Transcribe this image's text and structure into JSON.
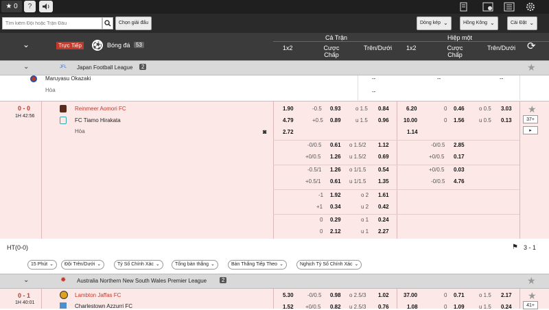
{
  "topbar": {
    "star_count": "0",
    "help": "?",
    "icons": [
      "sound-icon",
      "betslip-icon",
      "results-icon",
      "stats-icon",
      "settings-icon"
    ]
  },
  "search": {
    "placeholder": "Tìm kiếm Đội hoặc Trận Đấu",
    "choose_label": "Chọn giải đấu"
  },
  "dropdowns": {
    "odds_type": "Dòng kép",
    "odds_format": "Hồng Kông",
    "settings": "Cài Đặt"
  },
  "header": {
    "live_label": "Trực Tiếp",
    "sport": "Bóng đá",
    "sport_count": "53",
    "full_time": "Cả Trận",
    "half_time": "Hiệp một",
    "col_1x2": "1x2",
    "col_handicap_1": "Cược",
    "col_handicap_2": "Chấp",
    "col_ou": "Trên/Dưới"
  },
  "league1": {
    "name": "Japan Football League",
    "count": "2"
  },
  "prev_match": {
    "team": "Maruyasu Okazaki",
    "draw": "Hòa",
    "dash": "--"
  },
  "match1": {
    "score_home": "0",
    "score_sep": "-",
    "score_away": "0",
    "time": "1H 42:56",
    "home": "Reinmeer Aomori FC",
    "away": "FC Tiamo Hirakata",
    "draw": "Hòa",
    "more": "37+",
    "ft_1x2": [
      "1.90",
      "4.79",
      "2.72"
    ],
    "ht_1x2": [
      "6.20",
      "10.00",
      "1.14"
    ],
    "ft_hdp_main": {
      "lines": [
        "-0.5",
        "+0.5"
      ],
      "odds": [
        "0.93",
        "0.89"
      ]
    },
    "ft_ou_main": {
      "lines": [
        "o 1.5",
        "u 1.5"
      ],
      "odds": [
        "0.84",
        "0.96"
      ]
    },
    "ht_hdp_main": {
      "lines": [
        "0",
        "0"
      ],
      "odds": [
        "0.46",
        "1.56"
      ]
    },
    "ht_ou_main": {
      "lines": [
        "o 0.5",
        "u 0.5"
      ],
      "odds": [
        "3.03",
        "0.13"
      ]
    },
    "extra_rows": [
      {
        "hdp": [
          "-0/0.5",
          "+0/0.5"
        ],
        "hdp_odds": [
          "0.61",
          "1.26"
        ],
        "ou": [
          "o 1.5/2",
          "u 1.5/2"
        ],
        "ou_odds": [
          "1.12",
          "0.69"
        ],
        "ht_hdp": [
          "-0/0.5",
          "+0/0.5"
        ],
        "ht_hdp_odds": [
          "2.85",
          "0.17"
        ]
      },
      {
        "hdp": [
          "-0.5/1",
          "+0.5/1"
        ],
        "hdp_odds": [
          "1.26",
          "0.61"
        ],
        "ou": [
          "o 1/1.5",
          "u 1/1.5"
        ],
        "ou_odds": [
          "0.54",
          "1.35"
        ],
        "ht_hdp": [
          "+0/0.5",
          "-0/0.5"
        ],
        "ht_hdp_odds": [
          "0.03",
          "4.76"
        ]
      },
      {
        "hdp": [
          "-1",
          "+1"
        ],
        "hdp_odds": [
          "1.92",
          "0.34"
        ],
        "ou": [
          "o 2",
          "u 2"
        ],
        "ou_odds": [
          "1.61",
          "0.42"
        ],
        "ht_hdp": [
          "",
          ""
        ],
        "ht_hdp_odds": [
          "",
          ""
        ]
      },
      {
        "hdp": [
          "0",
          "0"
        ],
        "hdp_odds": [
          "0.29",
          "2.12"
        ],
        "ou": [
          "o 1",
          "u 1"
        ],
        "ou_odds": [
          "0.24",
          "2.27"
        ],
        "ht_hdp": [
          "",
          ""
        ],
        "ht_hdp_odds": [
          "",
          ""
        ]
      }
    ]
  },
  "ht_bar": {
    "label": "HT(0-0)",
    "corner": "3 - 1"
  },
  "tabs": [
    "15 Phút",
    "Đội Trên/Dưới",
    "Tỷ Số Chính Xác",
    "Tổng bàn thắng",
    "Bàn Thắng Tiếp Theo",
    "Nghịch Tỷ Số Chính Xác"
  ],
  "league2": {
    "name": "Australia Northern New South Wales Premier League",
    "count": "2"
  },
  "match2": {
    "score_home": "0",
    "score_sep": "-",
    "score_away": "1",
    "time": "1H 40:01",
    "home": "Lambton Jaffas FC",
    "away": "Charlestown Azzurri FC",
    "more": "41+",
    "ft_1x2": [
      "5.30",
      "1.52"
    ],
    "ft_hdp": {
      "lines": [
        "-0/0.5",
        "+0/0.5"
      ],
      "odds": [
        "0.98",
        "0.82"
      ]
    },
    "ft_ou": {
      "lines": [
        "o 2.5/3",
        "u 2.5/3"
      ],
      "odds": [
        "1.02",
        "0.76"
      ]
    },
    "ht_1x2": [
      "37.00",
      "1.08"
    ],
    "ht_hdp": {
      "lines": [
        "0",
        "0"
      ],
      "odds": [
        "0.71",
        "1.09"
      ]
    },
    "ht_ou": {
      "lines": [
        "o 1.5",
        "u 1.5"
      ],
      "odds": [
        "2.17",
        "0.24"
      ]
    }
  }
}
